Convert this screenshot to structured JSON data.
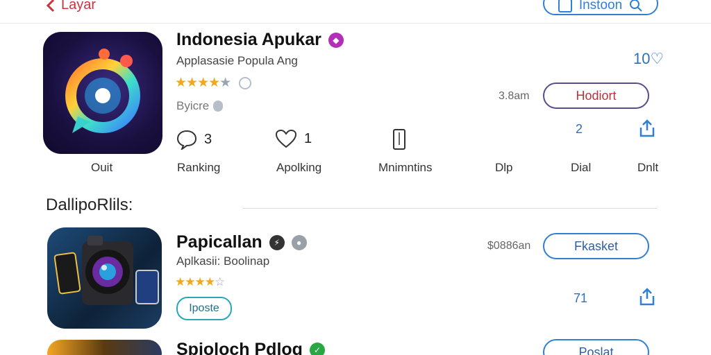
{
  "header": {
    "back_label": "Layar",
    "action_label": "Instoon"
  },
  "app1": {
    "name": "Indonesia Apukar",
    "subtitle": "Applasasie Popula Ang",
    "rating_stars": 4,
    "meta_label": "Byicre",
    "right_number": "10",
    "size_text": "3.8am",
    "button_label": "Hodiort",
    "stat_number": "2",
    "stats": [
      {
        "icon": "chat-icon",
        "value": "3"
      },
      {
        "icon": "heart-icon",
        "value": "1"
      },
      {
        "icon": "phone-icon",
        "value": ""
      }
    ],
    "labels": [
      "Ouit",
      "Ranking",
      "Apolking",
      "Mnimntins",
      "Dlp",
      "Dial",
      "Dnlt"
    ],
    "colors": {
      "badge": "#b42fb8",
      "button_border": "#5b4b8a",
      "button_text": "#c0303a"
    }
  },
  "section": {
    "title": "DallipoRlils:"
  },
  "app2": {
    "name": "Papicallan",
    "subtitle": "Aplkasii: Boolinap",
    "rating_stars": 4,
    "tag_label": "Iposte",
    "price": "$0886an",
    "button_label": "Fkasket",
    "stat_number": "71",
    "colors": {
      "badge_dark": "#333333",
      "badge_gray": "#9aa0a8"
    }
  },
  "app3": {
    "name": "Spioloch Pdlog",
    "button_label": "Poslat",
    "colors": {
      "badge": "#29a744"
    }
  },
  "colors": {
    "accent": "#2f7fd3",
    "back": "#c8343b",
    "star": "#f0a81d"
  }
}
